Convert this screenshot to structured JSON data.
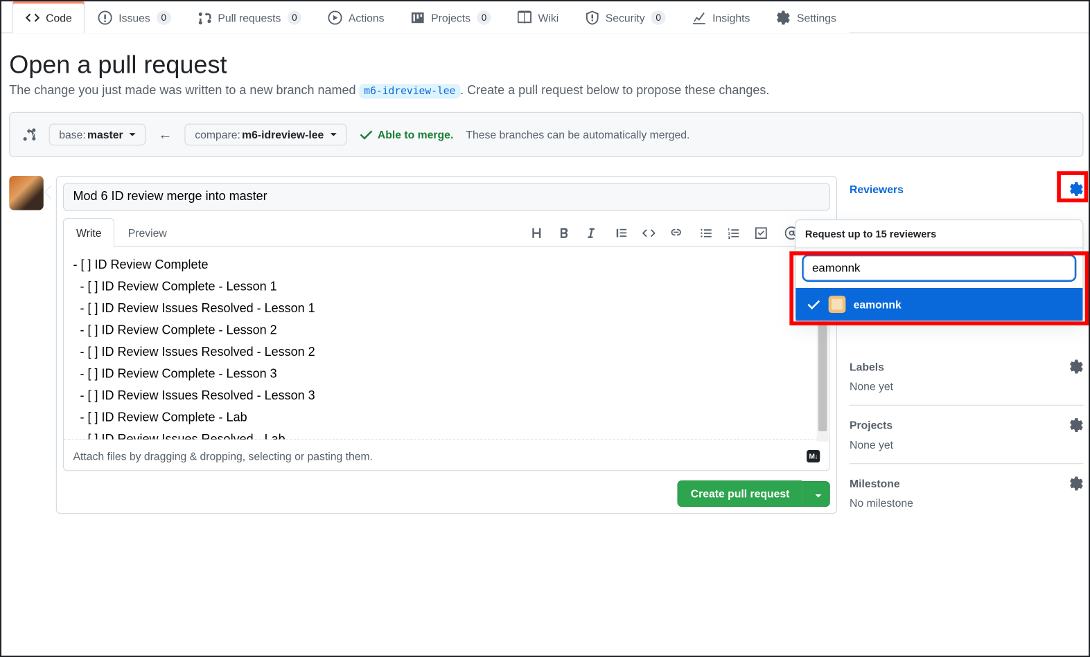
{
  "tabs": [
    {
      "icon": "code",
      "label": "Code",
      "count": null,
      "active": true
    },
    {
      "icon": "issue",
      "label": "Issues",
      "count": "0"
    },
    {
      "icon": "pr",
      "label": "Pull requests",
      "count": "0"
    },
    {
      "icon": "play",
      "label": "Actions",
      "count": null
    },
    {
      "icon": "project",
      "label": "Projects",
      "count": "0"
    },
    {
      "icon": "book",
      "label": "Wiki",
      "count": null
    },
    {
      "icon": "shield",
      "label": "Security",
      "count": "0"
    },
    {
      "icon": "graph",
      "label": "Insights",
      "count": null
    },
    {
      "icon": "gear",
      "label": "Settings",
      "count": null
    }
  ],
  "heading": {
    "title": "Open a pull request",
    "sub_pre": "The change you just made was written to a new branch named ",
    "sub_branch": "m6-idreview-lee",
    "sub_post": ". Create a pull request below to propose these changes."
  },
  "compare": {
    "base_label": "base: ",
    "base_value": "master",
    "compare_label": "compare: ",
    "compare_value": "m6-idreview-lee",
    "ok": "Able to merge.",
    "msg": "These branches can be automatically merged."
  },
  "compose": {
    "title": "Mod 6 ID review merge into master",
    "write": "Write",
    "preview": "Preview",
    "body": "- [ ] ID Review Complete\n  - [ ] ID Review Complete - Lesson 1\n  - [ ] ID Review Issues Resolved - Lesson 1\n  - [ ] ID Review Complete - Lesson 2\n  - [ ] ID Review Issues Resolved - Lesson 2\n  - [ ] ID Review Complete - Lesson 3\n  - [ ] ID Review Issues Resolved - Lesson 3\n  - [ ] ID Review Complete - Lab\n  - [ ] ID Review Issues Resolved - Lab",
    "attach": "Attach files by dragging & dropping, selecting or pasting them.",
    "md": "M↓",
    "submit": "Create pull request"
  },
  "sidebar": {
    "reviewers": "Reviewers",
    "labels": "Labels",
    "labels_val": "None yet",
    "projects": "Projects",
    "projects_val": "None yet",
    "milestone": "Milestone",
    "milestone_val": "No milestone"
  },
  "popover": {
    "header": "Request up to 15 reviewers",
    "search": "eamonnk",
    "result": "eamonnk"
  }
}
